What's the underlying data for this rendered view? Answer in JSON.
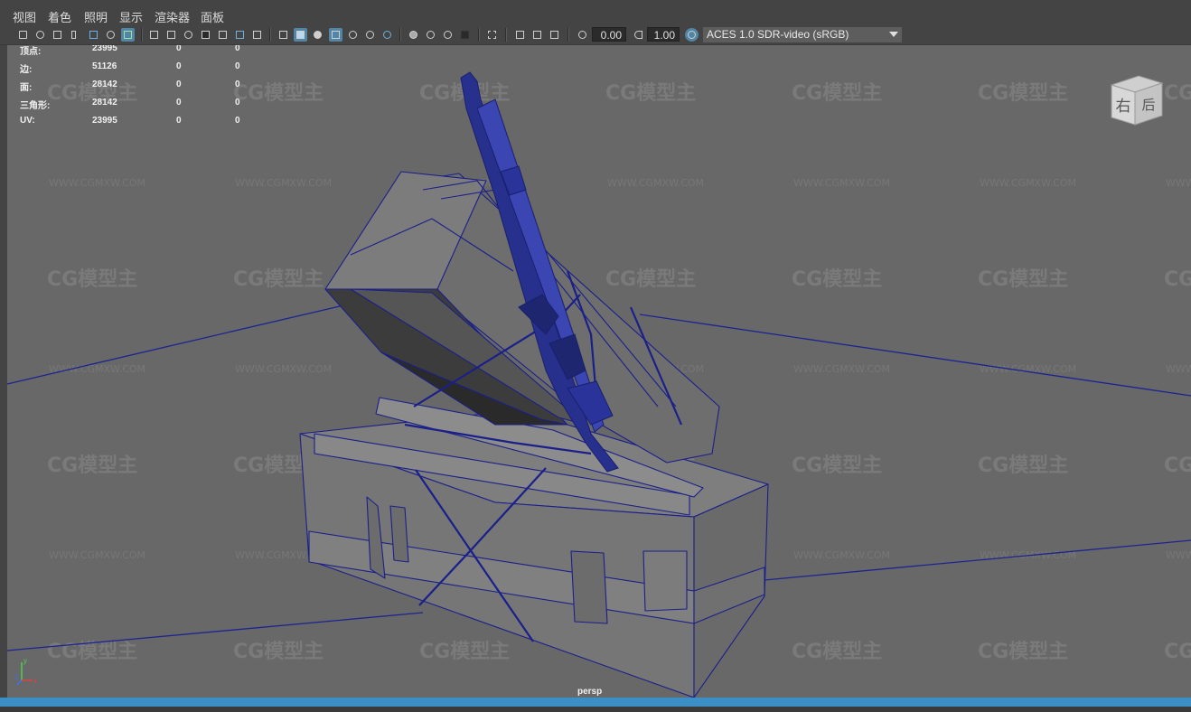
{
  "menu": [
    "视图",
    "着色",
    "照明",
    "显示",
    "渲染器",
    "面板"
  ],
  "toolbar": {
    "exposure_value": "0.00",
    "gamma_value": "1.00",
    "color_space": "ACES 1.0 SDR-video (sRGB)",
    "icons": [
      "camera-icon",
      "camera-attributes-icon",
      "bookmark-icon",
      "image-plane-icon",
      "grid-icon",
      "film-gate-icon",
      "resolution-gate-icon",
      "gate-mask-icon",
      "field-chart-icon",
      "safe-action-icon",
      "safe-title-icon",
      "wireframe-icon",
      "smooth-shade-icon",
      "use-default-material-icon",
      "wireframe-on-shaded-icon",
      "xray-icon",
      "xray-joints-icon",
      "lighting-icon",
      "shadows-icon",
      "screen-space-ao-icon",
      "motion-blur-icon",
      "multisample-aa-icon",
      "depth-of-field-icon",
      "isolate-select-icon",
      "xray-active-icon",
      "exposure-icon",
      "gamma-icon",
      "color-management-icon"
    ]
  },
  "hud": [
    {
      "label": "顶点:",
      "a": "23995",
      "b": "0",
      "c": "0"
    },
    {
      "label": "边:",
      "a": "51126",
      "b": "0",
      "c": "0"
    },
    {
      "label": "面:",
      "a": "28142",
      "b": "0",
      "c": "0"
    },
    {
      "label": "三角形:",
      "a": "28142",
      "b": "0",
      "c": "0"
    },
    {
      "label": "UV:",
      "a": "23995",
      "b": "0",
      "c": "0"
    }
  ],
  "viewcube": {
    "face_right": "右",
    "face_back": "后"
  },
  "camera_label": "persp",
  "axis": {
    "x": "x",
    "y": "y",
    "z": "z"
  },
  "watermark": {
    "logo": "CG模型主",
    "url": "WWW.CGMXW.COM"
  },
  "colors": {
    "wire": "#1a1f8a",
    "grid_line": "#1c2490",
    "active_icon": "#5285a6",
    "timebar": "#3b8fc4",
    "viewport_bg": "#686868"
  }
}
